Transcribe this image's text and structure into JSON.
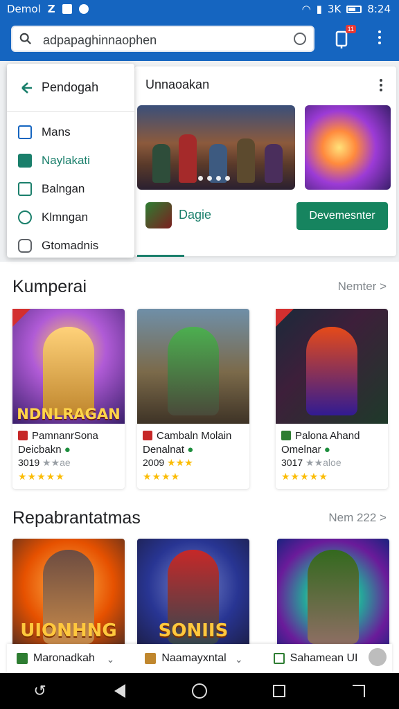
{
  "status_bar": {
    "left_text": "Demol",
    "left_glyph": "Z",
    "right_text": "3K",
    "time": "8:24"
  },
  "search": {
    "value": "adpapaghinnaophen",
    "icons": [
      "search-icon",
      "mic-icon"
    ]
  },
  "toolbar": {
    "notification_count": "11",
    "icons": [
      "phone-notification-icon",
      "overflow-menu-icon"
    ]
  },
  "menu": {
    "header": "Pendogah",
    "items": [
      {
        "label": "Mans",
        "icon": "square-icon"
      },
      {
        "label": "Naylakati",
        "icon": "check-icon"
      },
      {
        "label": "Balngan",
        "icon": "document-icon"
      },
      {
        "label": "Klmngan",
        "icon": "eye-icon"
      },
      {
        "label": "Gtomadnis",
        "icon": "chat-icon"
      }
    ]
  },
  "featured": {
    "title": "Unnaoakan",
    "app_name": "Dagie",
    "install_label": "Devemesnter"
  },
  "section1": {
    "title": "Kumperai",
    "more": "Nemter >",
    "games": [
      {
        "name1": "PamnanrSona",
        "name2": "Deicbakn",
        "year": "3019",
        "rating_text": "★★ae",
        "stars": "★★★★★",
        "art_text": "NDNLRAGAN"
      },
      {
        "name1": "Cambaln Molain",
        "name2": "Denalnat",
        "year": "2009",
        "rating_text": "★★★",
        "stars": "★★★★",
        "art_text": ""
      },
      {
        "name1": "Palona Ahand",
        "name2": "Omelnar",
        "year": "3017",
        "rating_text": "★★aloe",
        "stars": "★★★★★",
        "art_text": ""
      }
    ]
  },
  "section2": {
    "title": "Repabrantatmas",
    "more": "Nem 222 >",
    "art_texts": [
      "UIONHNG",
      "SONIIS",
      ""
    ]
  },
  "bottom_strip": {
    "items": [
      "Maronadkah",
      "Naamayxntal",
      "Sahamean UI"
    ]
  },
  "colors": {
    "brand_blue": "#1565c0",
    "accent_green": "#16845f",
    "star_yellow": "#fbbc04"
  }
}
